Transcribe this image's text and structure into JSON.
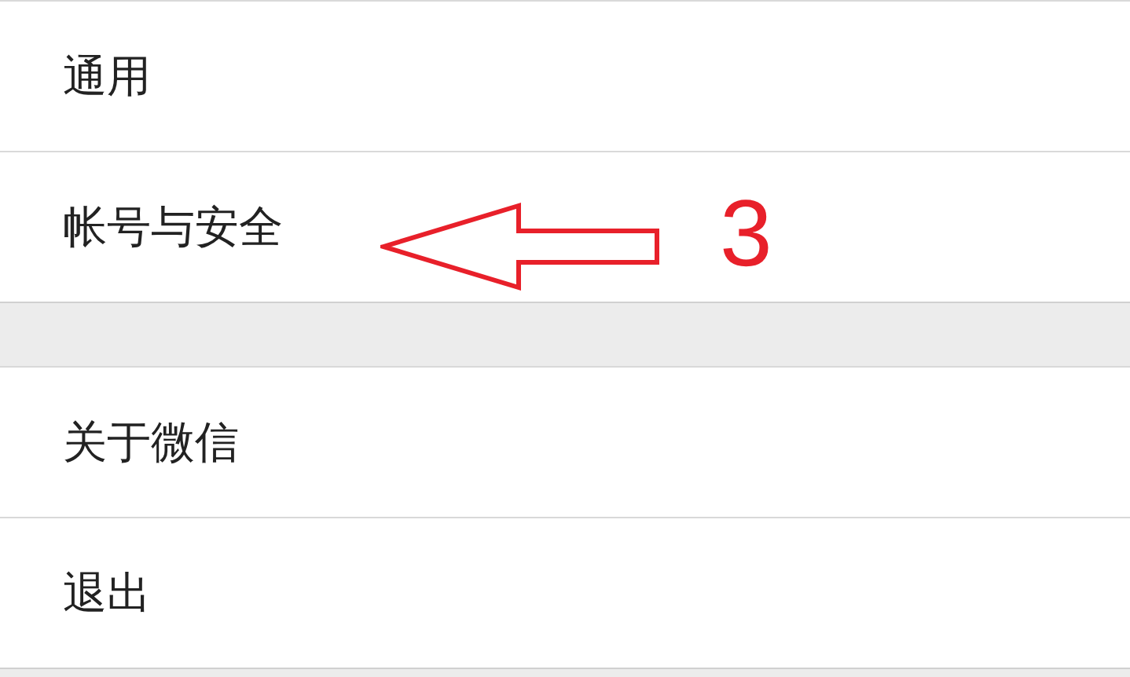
{
  "menu_groups": [
    {
      "items": [
        {
          "label": "通用"
        },
        {
          "label": "帐号与安全"
        }
      ]
    },
    {
      "items": [
        {
          "label": "关于微信"
        },
        {
          "label": "退出"
        }
      ]
    }
  ],
  "annotation": {
    "label": "3"
  }
}
